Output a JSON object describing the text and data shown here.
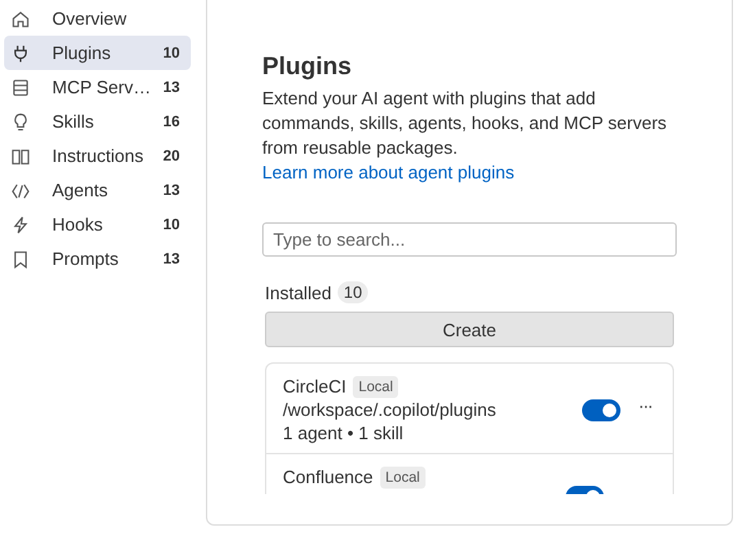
{
  "sidebar": {
    "items": [
      {
        "label": "Overview",
        "selected": false
      },
      {
        "label": "Plugins",
        "count": "10",
        "selected": true
      },
      {
        "label": "MCP Serv…",
        "count": "13",
        "selected": false
      },
      {
        "label": "Skills",
        "count": "16",
        "selected": false
      },
      {
        "label": "Instructions",
        "count": "20",
        "selected": false
      },
      {
        "label": "Agents",
        "count": "13",
        "selected": false
      },
      {
        "label": "Hooks",
        "count": "10",
        "selected": false
      },
      {
        "label": "Prompts",
        "count": "13",
        "selected": false
      }
    ]
  },
  "main": {
    "title": "Plugins",
    "description": "Extend your AI agent with plugins that add commands, skills, agents, hooks, and MCP servers from reusable packages.",
    "link": "Learn more about agent plugins",
    "search": {
      "placeholder": "Type to search..."
    },
    "installed": {
      "label": "Installed",
      "count": "10"
    },
    "create_button": "Create",
    "plugins": [
      {
        "name": "CircleCI",
        "badge": "Local",
        "path": "/workspace/.copilot/plugins",
        "summary": "1 agent • 1 skill",
        "on": true,
        "more": "···"
      },
      {
        "name": "Confluence",
        "badge": "Local",
        "on": true
      }
    ]
  }
}
